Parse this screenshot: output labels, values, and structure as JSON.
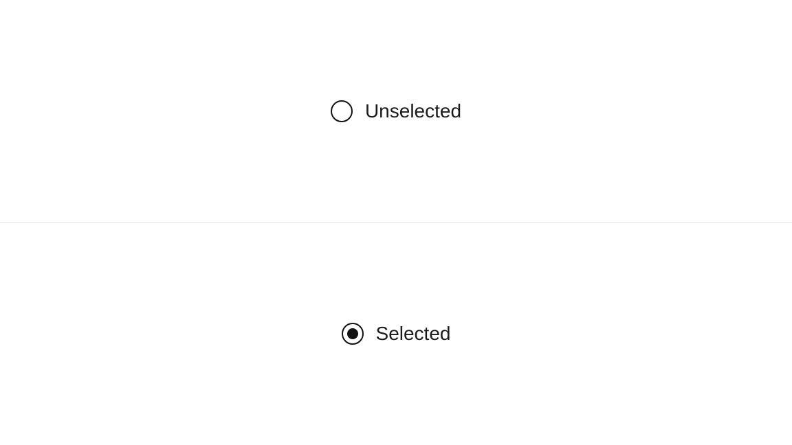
{
  "options": {
    "unselected": {
      "label": "Unselected",
      "selected": false
    },
    "selected": {
      "label": "Selected",
      "selected": true
    }
  }
}
